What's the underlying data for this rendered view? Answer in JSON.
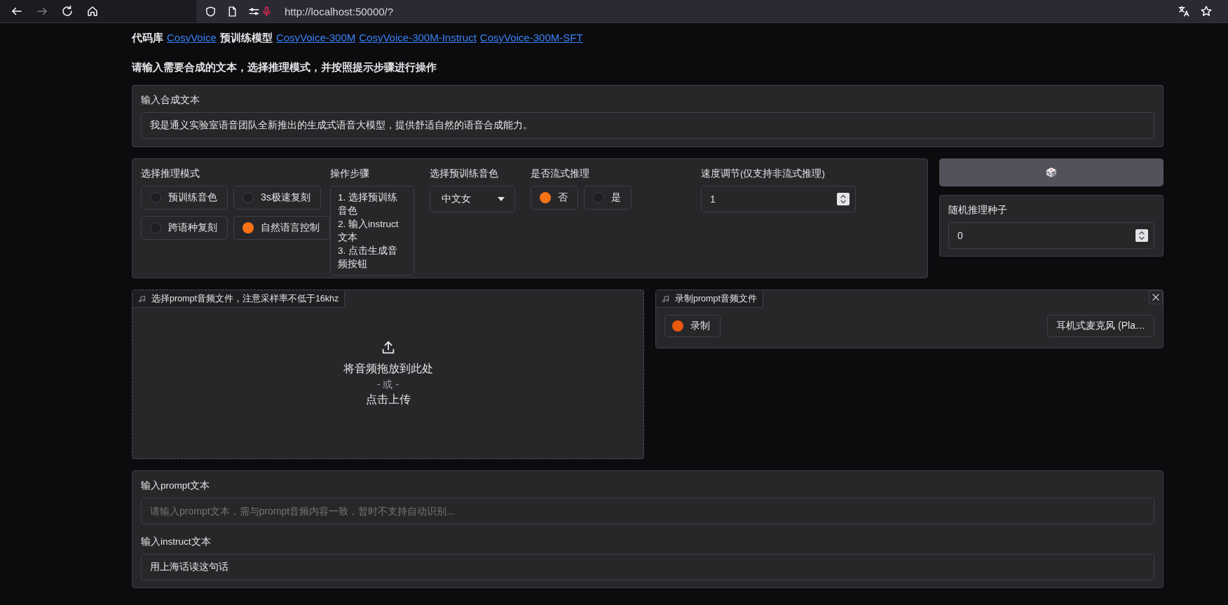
{
  "browser": {
    "url": "http://localhost:50000/?"
  },
  "header": [
    {
      "kind": "text",
      "text": "代码库"
    },
    {
      "kind": "link",
      "text": "CosyVoice"
    },
    {
      "kind": "text",
      "text": "预训练模型"
    },
    {
      "kind": "link",
      "text": "CosyVoice-300M"
    },
    {
      "kind": "link",
      "text": "CosyVoice-300M-Instruct"
    },
    {
      "kind": "link",
      "text": "CosyVoice-300M-SFT"
    }
  ],
  "subtitle": "请输入需要合成的文本，选择推理模式，并按照提示步骤进行操作",
  "tts_text": {
    "label": "输入合成文本",
    "value": "我是通义实验室语音团队全新推出的生成式语音大模型，提供舒适自然的语音合成能力。"
  },
  "mode": {
    "label": "选择推理模式",
    "options": [
      {
        "label": "预训练音色",
        "selected": false
      },
      {
        "label": "3s极速复刻",
        "selected": false
      },
      {
        "label": "跨语种复刻",
        "selected": false
      },
      {
        "label": "自然语言控制",
        "selected": true
      }
    ]
  },
  "steps": {
    "label": "操作步骤",
    "text": "1. 选择预训练音色\n2. 输入instruct文本\n3. 点击生成音频按钮"
  },
  "voice": {
    "label": "选择预训练音色",
    "value": "中文女"
  },
  "stream": {
    "label": "是否流式推理",
    "options": [
      {
        "label": "否",
        "selected": true
      },
      {
        "label": "是",
        "selected": false
      }
    ]
  },
  "speed": {
    "label": "速度调节(仅支持非流式推理)",
    "value": "1"
  },
  "seed": {
    "label": "随机推理种子",
    "value": "0"
  },
  "upload": {
    "label": "选择prompt音频文件，注意采样率不低于16khz",
    "drop": "将音频拖放到此处",
    "or": "- 或 -",
    "click": "点击上传"
  },
  "record": {
    "label": "录制prompt音频文件",
    "button": "录制",
    "device": "耳机式麦克风 (Pla…"
  },
  "prompt_text": {
    "label": "输入prompt文本",
    "placeholder": "请输入prompt文本，需与prompt音频内容一致，暂时不支持自动识别..."
  },
  "instruct_text": {
    "label": "输入instruct文本",
    "value": "用上海话读这句话"
  }
}
